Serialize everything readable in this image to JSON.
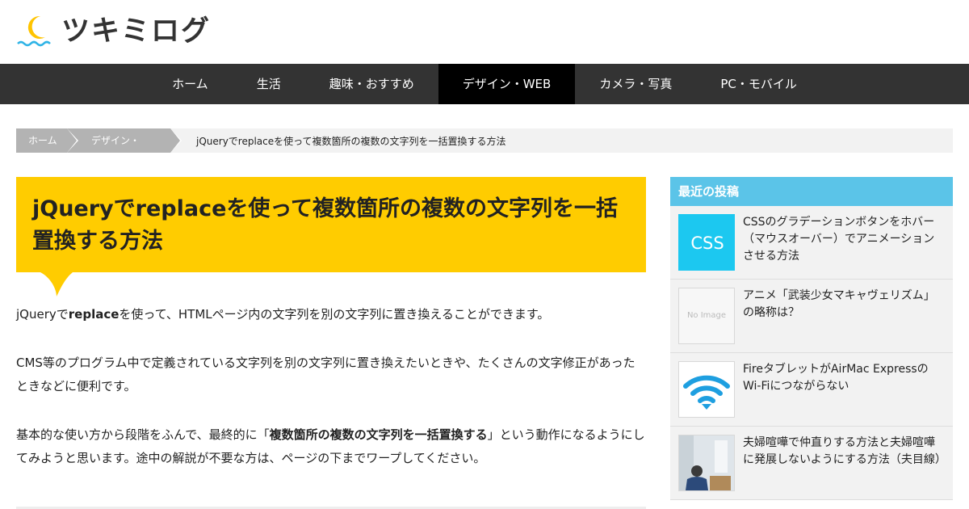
{
  "site": {
    "name": "ツキミログ"
  },
  "nav": [
    {
      "label": "ホーム",
      "active": false
    },
    {
      "label": "生活",
      "active": false
    },
    {
      "label": "趣味・おすすめ",
      "active": false
    },
    {
      "label": "デザイン・WEB",
      "active": true
    },
    {
      "label": "カメラ・写真",
      "active": false
    },
    {
      "label": "PC・モバイル",
      "active": false
    }
  ],
  "breadcrumb": {
    "home": "ホーム",
    "category": "デザイン・WEB",
    "current": "jQueryでreplaceを使って複数箇所の複数の文字列を一括置換する方法"
  },
  "article": {
    "title": "jQueryでreplaceを使って複数箇所の複数の文字列を一括置換する方法",
    "p1": {
      "a": "jQueryで",
      "b": "replace",
      "c": "を使って、HTMLページ内の文字列を別の文字列に置き換えることができます。"
    },
    "p2": "CMS等のプログラム中で定義されている文字列を別の文字列に置き換えたいときや、たくさんの文字修正があったときなどに便利です。",
    "p3": {
      "a": "基本的な使い方から段階をふんで、最終的に「",
      "b": "複数箇所の複数の文字列を一括置換する",
      "c": "」という動作になるようにしてみようと思います。途中の解説が不要な方は、ページの下までワープしてください。"
    }
  },
  "sidebar": {
    "title": "最近の投稿",
    "posts": [
      {
        "title": "CSSのグラデーションボタンをホバー（マウスオーバー）でアニメーションさせる方法",
        "thumb_text": "CSS",
        "thumb_color": "#1cc8f0"
      },
      {
        "title": "アニメ「武装少女マキャヴェリズム」の略称は？",
        "thumb_text": "No Image"
      },
      {
        "title": "FireタブレットがAirMac ExpressのWi-Fiにつながらない",
        "thumb_icon": "wifi-icon",
        "thumb_color": "#1e9fe0"
      },
      {
        "title": "夫婦喧嘩で仲直りする方法と夫婦喧嘩に発展しないようにする方法（夫目線）",
        "thumb_icon": "photo-thumbnail"
      }
    ]
  },
  "colors": {
    "accent_yellow": "#ffcc00",
    "nav_bg": "#333333",
    "nav_active": "#000000",
    "sidebar_header": "#5bc4e8",
    "breadcrumb_grey": "#b3b3b3"
  }
}
